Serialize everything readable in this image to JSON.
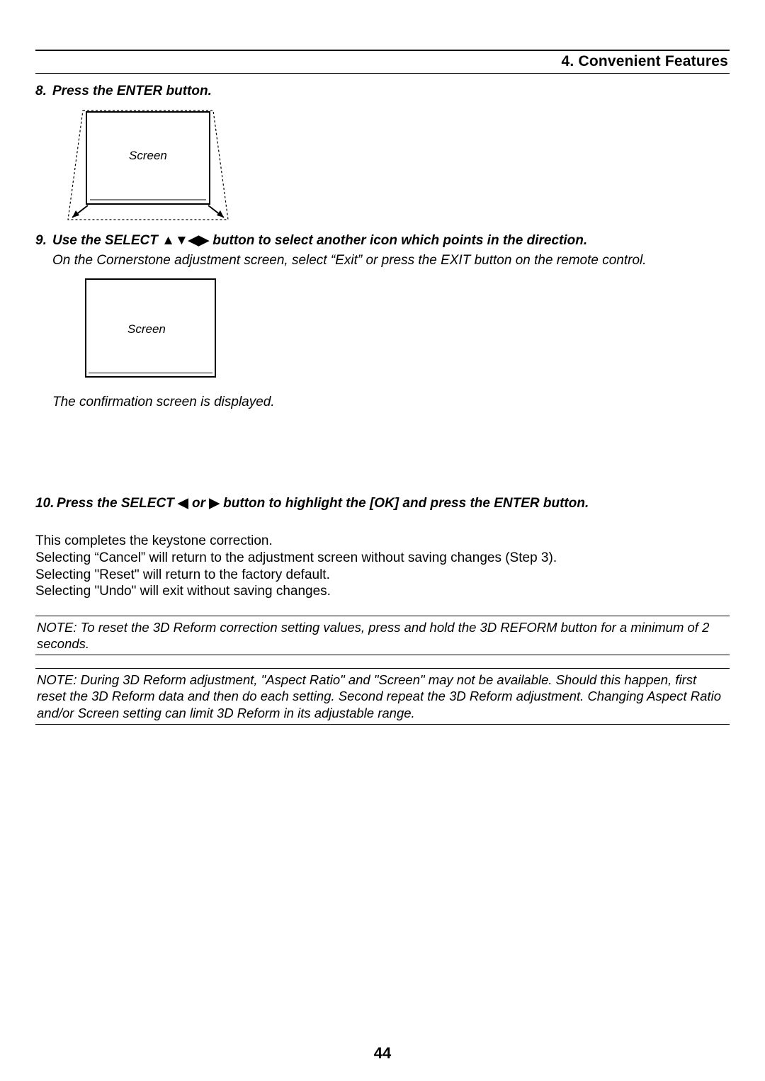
{
  "header": {
    "section": "4. Convenient Features"
  },
  "steps": {
    "s8": {
      "num": "8.",
      "text": "Press the ENTER button."
    },
    "s9": {
      "num": "9.",
      "prefix": "Use the SELECT ",
      "arrows": "▲▼◀▶",
      "suffix": " button to select another icon which points in the direction.",
      "line2": "On the Cornerstone adjustment screen, select “Exit” or press the EXIT button on the remote control.",
      "confirm": "The confirmation screen is displayed."
    },
    "s10": {
      "num": "10.",
      "prefix": "Press the SELECT ",
      "arrowL": "◀",
      "mid": " or ",
      "arrowR": "▶",
      "suffix": " button to highlight the [OK] and press the ENTER button."
    }
  },
  "fig": {
    "screen_label": "Screen"
  },
  "body": {
    "p1": "This completes the keystone correction.",
    "p2": "Selecting “Cancel” will return to the adjustment screen without saving changes (Step 3).",
    "p3": "Selecting \"Reset\" will return to the factory default.",
    "p4": "Selecting \"Undo\" will exit without saving changes."
  },
  "notes": {
    "n1": "NOTE: To reset the 3D Reform correction setting values, press and hold the 3D REFORM button for a minimum of 2 seconds.",
    "n2": "NOTE: During 3D Reform adjustment, \"Aspect Ratio\" and \"Screen\" may not be available. Should this happen, first reset the 3D Reform data and then do each setting. Second repeat the 3D Reform adjustment. Changing Aspect Ratio and/or Screen setting can limit 3D Reform in its adjustable range."
  },
  "page_number": "44"
}
